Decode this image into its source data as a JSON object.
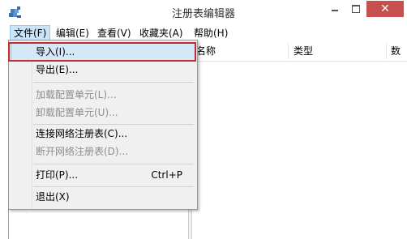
{
  "window": {
    "title": "注册表编辑器",
    "close_glyph": "✕"
  },
  "menubar": {
    "items": [
      {
        "label": "文件(F)"
      },
      {
        "label": "编辑(E)"
      },
      {
        "label": "查看(V)"
      },
      {
        "label": "收藏夹(A)"
      },
      {
        "label": "帮助(H)"
      }
    ]
  },
  "columns": {
    "name": "名称",
    "type": "类型",
    "data": "数"
  },
  "file_menu": {
    "items": [
      {
        "label": "导入(I)...",
        "shortcut": "",
        "enabled": true
      },
      {
        "label": "导出(E)...",
        "shortcut": "",
        "enabled": true
      },
      {
        "label": "加载配置单元(L)...",
        "shortcut": "",
        "enabled": false
      },
      {
        "label": "卸载配置单元(U)...",
        "shortcut": "",
        "enabled": false
      },
      {
        "label": "连接网络注册表(C)...",
        "shortcut": "",
        "enabled": true
      },
      {
        "label": "断开网络注册表(D)...",
        "shortcut": "",
        "enabled": false
      },
      {
        "label": "打印(P)...",
        "shortcut": "Ctrl+P",
        "enabled": true
      },
      {
        "label": "退出(X)",
        "shortcut": "",
        "enabled": true
      }
    ],
    "highlighted_index": 0
  },
  "colors": {
    "close_button": "#c7504f",
    "highlight_frame": "#c02a33",
    "menu_background": "#f0f0f0",
    "disabled_text": "#8d8d8d"
  },
  "icons": {
    "app": "registry-editor-icon"
  }
}
